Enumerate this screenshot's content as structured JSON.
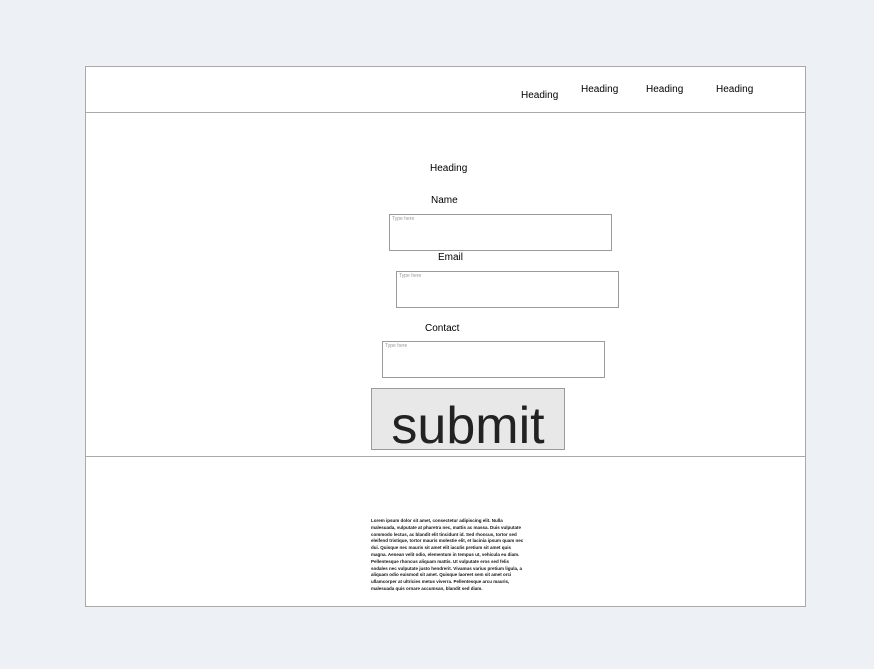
{
  "header": {
    "nav": [
      {
        "label": "Heading"
      },
      {
        "label": "Heading"
      },
      {
        "label": "Heading"
      },
      {
        "label": "Heading"
      }
    ]
  },
  "form": {
    "heading": "Heading",
    "name_label": "Name",
    "name_placeholder": "Type here",
    "email_label": "Email",
    "email_placeholder": "Type here",
    "contact_label": "Contact",
    "contact_placeholder": "Type here",
    "submit_label": "submit"
  },
  "footer": {
    "text": "Lorem ipsum dolor sit amet, consectetur adipiscing elit. Nulla malesuada, vulputate at pharetra nec, mattis ac massa. Duis vulputate commodo lectus, ac blandit elit tincidunt id. Sed rhoncus, tortor sed eleifend tristique, tortor mauris molestie elit, et lacinia ipsum quam nec dui. Quisque nec mauris sit amet elit iaculis pretium sit amet quis magna. Aenean velit odio, elementum in tempus ut, vehicula eu diam. Pellentesque rhoncus aliquam mattis. Ut vulputate eros sed felis sodales nec vulputate justo hendrerit. Vivamus varius pretium ligula, a aliquam odio euismod sit amet. Quisque laoreet sem sit amet orci ullamcorper at ultricies metus viverra. Pellentesque arcu mauris, malesuada quis ornare accumsan, blandit sed diam."
  }
}
